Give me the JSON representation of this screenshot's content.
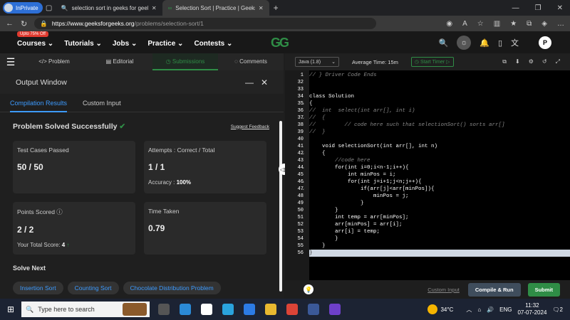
{
  "browser": {
    "profile_label": "InPrivate",
    "tabs": [
      {
        "title": "selection sort in geeks for geeks",
        "active": false
      },
      {
        "title": "Selection Sort | Practice | GeeksforGeeks",
        "active": true
      }
    ],
    "url_host": "https://www.geeksforgeeks.org",
    "url_path": "/problems/selection-sort/1"
  },
  "site": {
    "promo": "Upto 75% Off",
    "menu": [
      "Courses",
      "Tutorials",
      "Jobs",
      "Practice",
      "Contests"
    ],
    "logo": "GG",
    "profile_initial": "P"
  },
  "subtabs": [
    "Problem",
    "Editorial",
    "Submissions",
    "Comments"
  ],
  "output": {
    "title": "Output Window",
    "tabs": [
      "Compilation Results",
      "Custom Input"
    ],
    "status": "Problem Solved Successfully",
    "feedback": "Suggest Feedback",
    "cards": {
      "test_label": "Test Cases Passed",
      "test_value": "50 / 50",
      "attempts_label": "Attempts : Correct / Total",
      "attempts_value": "1 / 1",
      "accuracy_label": "Accuracy :",
      "accuracy_value": "100%",
      "points_label": "Points Scored",
      "points_value": "2 / 2",
      "total_label": "Your Total Score:",
      "total_value": "4",
      "time_label": "Time Taken",
      "time_value": "0.79"
    },
    "solve_next": "Solve Next",
    "next_problems": [
      "Insertion Sort",
      "Counting Sort",
      "Chocolate Distribution Problem"
    ]
  },
  "editor": {
    "language": "Java (1.8)",
    "avg_time": "Average Time: 15m",
    "timer": "Start Timer",
    "lines": [
      {
        "n": "1",
        "text": "// } Driver Code Ends",
        "type": "comment"
      },
      {
        "n": "32",
        "text": "",
        "type": "code"
      },
      {
        "n": "33",
        "text": "",
        "type": "code"
      },
      {
        "n": "34",
        "text": "class Solution",
        "type": "code"
      },
      {
        "n": "35",
        "text": "{",
        "type": "code"
      },
      {
        "n": "36",
        "text": "//  int  select(int arr[], int i)",
        "type": "comment"
      },
      {
        "n": "37",
        "text": "//  {",
        "type": "comment"
      },
      {
        "n": "38",
        "text": "//         // code here such that selectionSort() sorts arr[]",
        "type": "comment"
      },
      {
        "n": "39",
        "text": "//  }",
        "type": "comment"
      },
      {
        "n": "40",
        "text": "",
        "type": "code"
      },
      {
        "n": "41",
        "text": "    void selectionSort(int arr[], int n)",
        "type": "code"
      },
      {
        "n": "42",
        "text": "    {",
        "type": "code"
      },
      {
        "n": "43",
        "text": "        //code here",
        "type": "comment"
      },
      {
        "n": "44",
        "text": "        for(int i=0;i<n-1;i++){",
        "type": "code"
      },
      {
        "n": "45",
        "text": "            int minPos = i;",
        "type": "code"
      },
      {
        "n": "46",
        "text": "            for(int j=i+1;j<n;j++){",
        "type": "code"
      },
      {
        "n": "47",
        "text": "                if(arr[j]<arr[minPos]){",
        "type": "code"
      },
      {
        "n": "48",
        "text": "                    minPos = j;",
        "type": "code"
      },
      {
        "n": "49",
        "text": "                }",
        "type": "code"
      },
      {
        "n": "50",
        "text": "        }",
        "type": "code"
      },
      {
        "n": "51",
        "text": "        int temp = arr[minPos];",
        "type": "code"
      },
      {
        "n": "52",
        "text": "        arr[minPos] = arr[i];",
        "type": "code"
      },
      {
        "n": "53",
        "text": "        arr[i] = temp;",
        "type": "code"
      },
      {
        "n": "54",
        "text": "        }",
        "type": "code"
      },
      {
        "n": "55",
        "text": "    }",
        "type": "code"
      },
      {
        "n": "56",
        "text": "}",
        "type": "highlight"
      }
    ],
    "custom_input": "Custom Input",
    "compile_run": "Compile & Run",
    "submit": "Submit"
  },
  "taskbar": {
    "search_placeholder": "Type here to search",
    "temperature": "34°C",
    "lang": "ENG",
    "time": "11:32",
    "date": "07-07-2024",
    "notifications": "2"
  },
  "colors": {
    "accent": "#2f8d46",
    "link": "#3d9bff"
  }
}
